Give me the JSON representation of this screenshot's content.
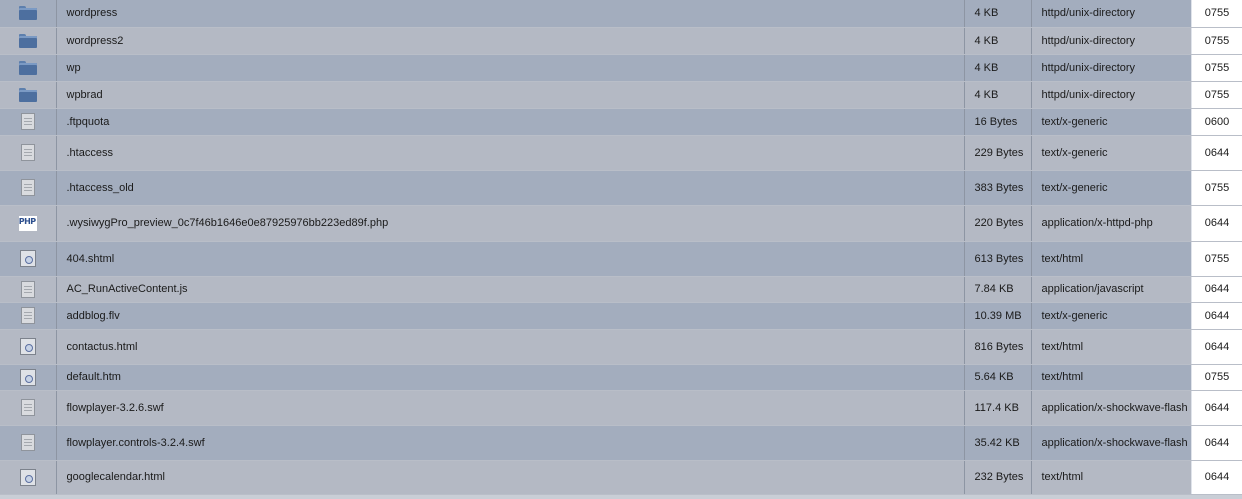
{
  "files": [
    {
      "name": "wordpress",
      "size": "4 KB",
      "type": "httpd/unix-directory",
      "perms": "0755",
      "icon": "folder-icon"
    },
    {
      "name": "wordpress2",
      "size": "4 KB",
      "type": "httpd/unix-directory",
      "perms": "0755",
      "icon": "folder-icon"
    },
    {
      "name": "wp",
      "size": "4 KB",
      "type": "httpd/unix-directory",
      "perms": "0755",
      "icon": "folder-icon"
    },
    {
      "name": "wpbrad",
      "size": "4 KB",
      "type": "httpd/unix-directory",
      "perms": "0755",
      "icon": "folder-icon"
    },
    {
      "name": ".ftpquota",
      "size": "16 Bytes",
      "type": "text/x-generic",
      "perms": "0600",
      "icon": "generic-file-icon"
    },
    {
      "name": ".htaccess",
      "size": "229 Bytes",
      "type": "text/x-generic",
      "perms": "0644",
      "icon": "generic-file-icon"
    },
    {
      "name": ".htaccess_old",
      "size": "383 Bytes",
      "type": "text/x-generic",
      "perms": "0755",
      "icon": "generic-file-icon"
    },
    {
      "name": ".wysiwygPro_preview_0c7f46b1646e0e87925976bb223ed89f.php",
      "size": "220 Bytes",
      "type": "application/x-httpd-php",
      "perms": "0644",
      "icon": "php-file-icon"
    },
    {
      "name": "404.shtml",
      "size": "613 Bytes",
      "type": "text/html",
      "perms": "0755",
      "icon": "html-file-icon"
    },
    {
      "name": "AC_RunActiveContent.js",
      "size": "7.84 KB",
      "type": "application/javascript",
      "perms": "0644",
      "icon": "generic-file-icon"
    },
    {
      "name": "addblog.flv",
      "size": "10.39 MB",
      "type": "text/x-generic",
      "perms": "0644",
      "icon": "generic-file-icon"
    },
    {
      "name": "contactus.html",
      "size": "816 Bytes",
      "type": "text/html",
      "perms": "0644",
      "icon": "html-file-icon"
    },
    {
      "name": "default.htm",
      "size": "5.64 KB",
      "type": "text/html",
      "perms": "0755",
      "icon": "html-file-icon"
    },
    {
      "name": "flowplayer-3.2.6.swf",
      "size": "117.4 KB",
      "type": "application/x-shockwave-flash",
      "perms": "0644",
      "icon": "generic-file-icon"
    },
    {
      "name": "flowplayer.controls-3.2.4.swf",
      "size": "35.42 KB",
      "type": "application/x-shockwave-flash",
      "perms": "0644",
      "icon": "generic-file-icon"
    },
    {
      "name": "googlecalendar.html",
      "size": "232 Bytes",
      "type": "text/html",
      "perms": "0644",
      "icon": "html-file-icon"
    }
  ]
}
